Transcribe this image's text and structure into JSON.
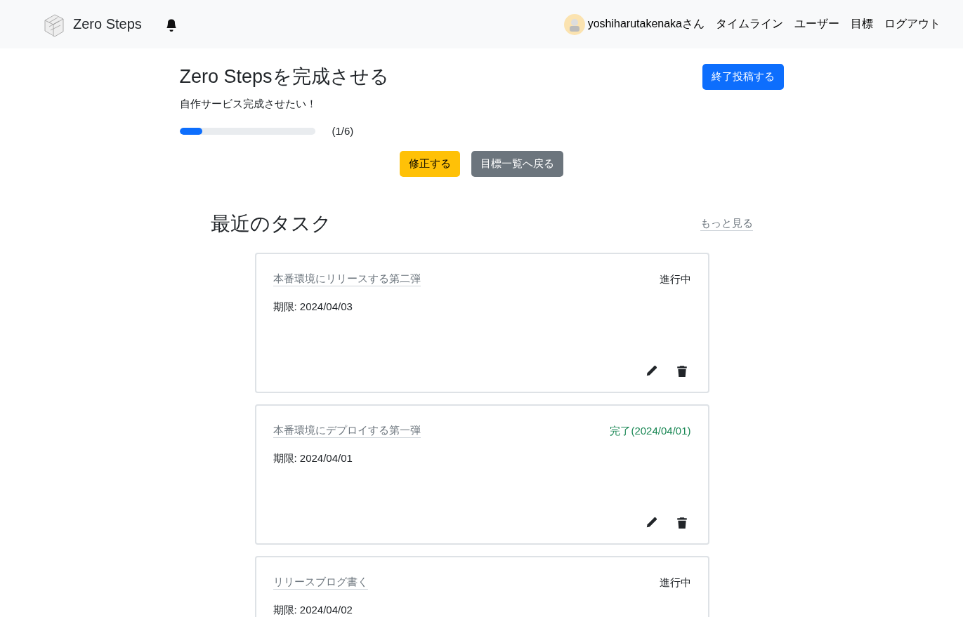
{
  "navbar": {
    "brand": "Zero Steps",
    "user": "yoshiharutakenakaさん",
    "links": [
      "タイムライン",
      "ユーザー",
      "目標",
      "ログアウト"
    ]
  },
  "goal": {
    "title": "Zero Stepsを完成させる",
    "description": "自作サービス完成させたい！",
    "level": 0.1667,
    "progress_text": "(1/6)",
    "finish_button": "終了投稿する",
    "edit_button": "修正する",
    "back_button": "目標一覧へ戻る"
  },
  "tasks_section": {
    "heading": "最近のタスク",
    "more_link": "もっと見る",
    "tasks": [
      {
        "title": "本番環境にリリースする第二弾",
        "status": "進行中",
        "kind": "in_progress",
        "deadline": "期限: 2024/04/03"
      },
      {
        "title": "本番環境にデプロイする第一弾",
        "status": "完了(2024/04/01)",
        "kind": "done",
        "deadline": "期限: 2024/04/01"
      },
      {
        "title": "リリースブログ書く",
        "status": "進行中",
        "kind": "in_progress",
        "deadline": "期限: 2024/04/02"
      }
    ]
  }
}
